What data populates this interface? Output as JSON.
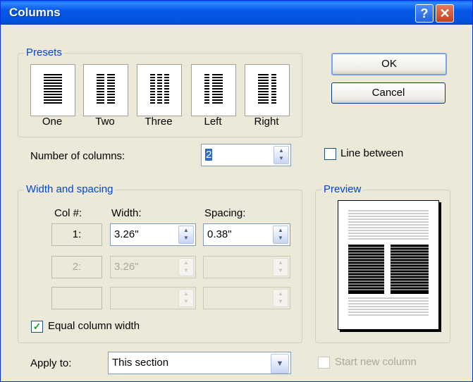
{
  "window": {
    "title": "Columns",
    "help_glyph": "?",
    "close_glyph": "✕"
  },
  "presets": {
    "label": "Presets",
    "items": [
      "One",
      "Two",
      "Three",
      "Left",
      "Right"
    ]
  },
  "buttons": {
    "ok": "OK",
    "cancel": "Cancel"
  },
  "number_of_columns": {
    "label": "Number of columns:",
    "value": "2"
  },
  "line_between": {
    "label": "Line between",
    "checked": false
  },
  "width_spacing": {
    "label": "Width and spacing",
    "col_header": "Col #:",
    "width_header": "Width:",
    "spacing_header": "Spacing:",
    "rows": [
      {
        "col": "1:",
        "width": "3.26\"",
        "spacing": "0.38\""
      },
      {
        "col": "2:",
        "width": "3.26\"",
        "spacing": ""
      },
      {
        "col": "",
        "width": "",
        "spacing": ""
      }
    ]
  },
  "equal_column_width": {
    "label": "Equal column width",
    "checked": true
  },
  "preview": {
    "label": "Preview"
  },
  "apply_to": {
    "label": "Apply to:",
    "value": "This section"
  },
  "start_new_column": {
    "label": "Start new column",
    "checked": false
  }
}
